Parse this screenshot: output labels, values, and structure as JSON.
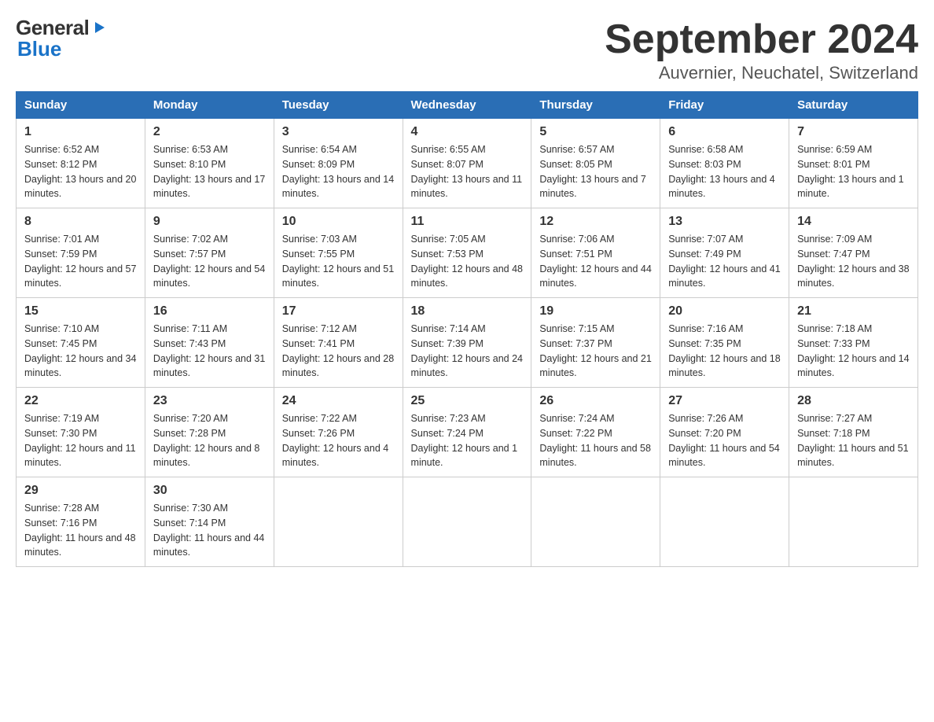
{
  "header": {
    "logo_text1": "General",
    "logo_text2": "Blue",
    "month_title": "September 2024",
    "location": "Auvernier, Neuchatel, Switzerland"
  },
  "weekdays": [
    "Sunday",
    "Monday",
    "Tuesday",
    "Wednesday",
    "Thursday",
    "Friday",
    "Saturday"
  ],
  "weeks": [
    [
      {
        "day": "1",
        "sunrise": "6:52 AM",
        "sunset": "8:12 PM",
        "daylight": "13 hours and 20 minutes."
      },
      {
        "day": "2",
        "sunrise": "6:53 AM",
        "sunset": "8:10 PM",
        "daylight": "13 hours and 17 minutes."
      },
      {
        "day": "3",
        "sunrise": "6:54 AM",
        "sunset": "8:09 PM",
        "daylight": "13 hours and 14 minutes."
      },
      {
        "day": "4",
        "sunrise": "6:55 AM",
        "sunset": "8:07 PM",
        "daylight": "13 hours and 11 minutes."
      },
      {
        "day": "5",
        "sunrise": "6:57 AM",
        "sunset": "8:05 PM",
        "daylight": "13 hours and 7 minutes."
      },
      {
        "day": "6",
        "sunrise": "6:58 AM",
        "sunset": "8:03 PM",
        "daylight": "13 hours and 4 minutes."
      },
      {
        "day": "7",
        "sunrise": "6:59 AM",
        "sunset": "8:01 PM",
        "daylight": "13 hours and 1 minute."
      }
    ],
    [
      {
        "day": "8",
        "sunrise": "7:01 AM",
        "sunset": "7:59 PM",
        "daylight": "12 hours and 57 minutes."
      },
      {
        "day": "9",
        "sunrise": "7:02 AM",
        "sunset": "7:57 PM",
        "daylight": "12 hours and 54 minutes."
      },
      {
        "day": "10",
        "sunrise": "7:03 AM",
        "sunset": "7:55 PM",
        "daylight": "12 hours and 51 minutes."
      },
      {
        "day": "11",
        "sunrise": "7:05 AM",
        "sunset": "7:53 PM",
        "daylight": "12 hours and 48 minutes."
      },
      {
        "day": "12",
        "sunrise": "7:06 AM",
        "sunset": "7:51 PM",
        "daylight": "12 hours and 44 minutes."
      },
      {
        "day": "13",
        "sunrise": "7:07 AM",
        "sunset": "7:49 PM",
        "daylight": "12 hours and 41 minutes."
      },
      {
        "day": "14",
        "sunrise": "7:09 AM",
        "sunset": "7:47 PM",
        "daylight": "12 hours and 38 minutes."
      }
    ],
    [
      {
        "day": "15",
        "sunrise": "7:10 AM",
        "sunset": "7:45 PM",
        "daylight": "12 hours and 34 minutes."
      },
      {
        "day": "16",
        "sunrise": "7:11 AM",
        "sunset": "7:43 PM",
        "daylight": "12 hours and 31 minutes."
      },
      {
        "day": "17",
        "sunrise": "7:12 AM",
        "sunset": "7:41 PM",
        "daylight": "12 hours and 28 minutes."
      },
      {
        "day": "18",
        "sunrise": "7:14 AM",
        "sunset": "7:39 PM",
        "daylight": "12 hours and 24 minutes."
      },
      {
        "day": "19",
        "sunrise": "7:15 AM",
        "sunset": "7:37 PM",
        "daylight": "12 hours and 21 minutes."
      },
      {
        "day": "20",
        "sunrise": "7:16 AM",
        "sunset": "7:35 PM",
        "daylight": "12 hours and 18 minutes."
      },
      {
        "day": "21",
        "sunrise": "7:18 AM",
        "sunset": "7:33 PM",
        "daylight": "12 hours and 14 minutes."
      }
    ],
    [
      {
        "day": "22",
        "sunrise": "7:19 AM",
        "sunset": "7:30 PM",
        "daylight": "12 hours and 11 minutes."
      },
      {
        "day": "23",
        "sunrise": "7:20 AM",
        "sunset": "7:28 PM",
        "daylight": "12 hours and 8 minutes."
      },
      {
        "day": "24",
        "sunrise": "7:22 AM",
        "sunset": "7:26 PM",
        "daylight": "12 hours and 4 minutes."
      },
      {
        "day": "25",
        "sunrise": "7:23 AM",
        "sunset": "7:24 PM",
        "daylight": "12 hours and 1 minute."
      },
      {
        "day": "26",
        "sunrise": "7:24 AM",
        "sunset": "7:22 PM",
        "daylight": "11 hours and 58 minutes."
      },
      {
        "day": "27",
        "sunrise": "7:26 AM",
        "sunset": "7:20 PM",
        "daylight": "11 hours and 54 minutes."
      },
      {
        "day": "28",
        "sunrise": "7:27 AM",
        "sunset": "7:18 PM",
        "daylight": "11 hours and 51 minutes."
      }
    ],
    [
      {
        "day": "29",
        "sunrise": "7:28 AM",
        "sunset": "7:16 PM",
        "daylight": "11 hours and 48 minutes."
      },
      {
        "day": "30",
        "sunrise": "7:30 AM",
        "sunset": "7:14 PM",
        "daylight": "11 hours and 44 minutes."
      },
      null,
      null,
      null,
      null,
      null
    ]
  ]
}
